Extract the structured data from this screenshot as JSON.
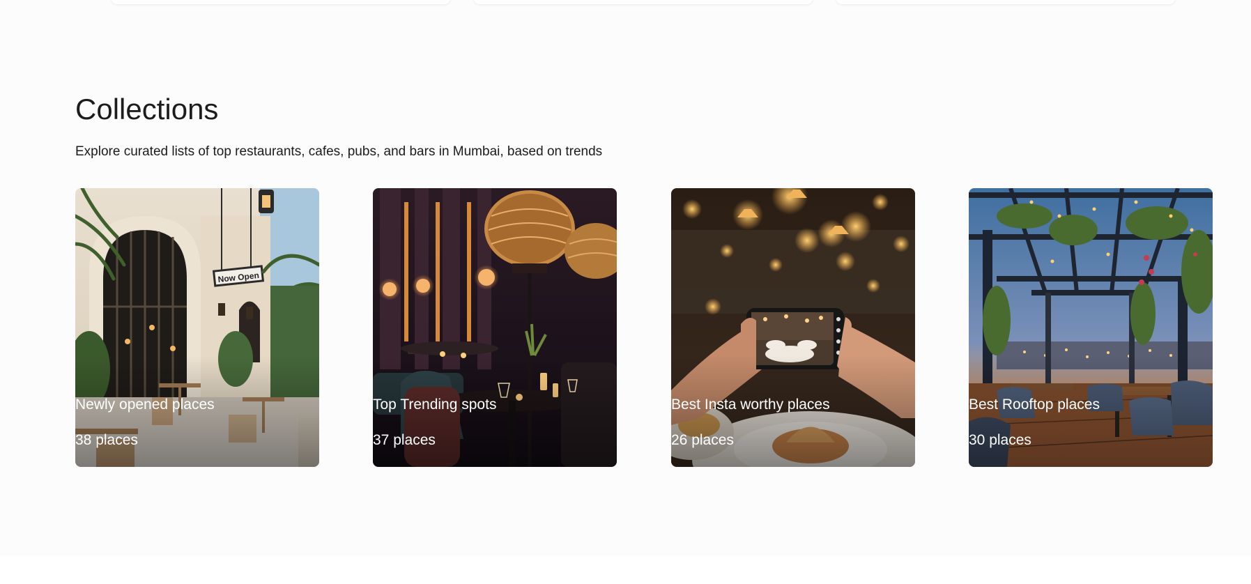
{
  "collections": {
    "title": "Collections",
    "subtitle": "Explore curated lists of top restaurants, cafes, pubs, and bars in Mumbai, based on trends",
    "cards": [
      {
        "name": "Newly opened places",
        "count": "38 places",
        "sign_text": "Now Open"
      },
      {
        "name": "Top Trending spots",
        "count": "37 places"
      },
      {
        "name": "Best Insta worthy places",
        "count": "26 places"
      },
      {
        "name": "Best Rooftop places",
        "count": "30 places"
      }
    ]
  },
  "colors": {
    "page_background": "#fcfcfc",
    "text": "#1c1c1c",
    "card_text": "#ffffff"
  }
}
